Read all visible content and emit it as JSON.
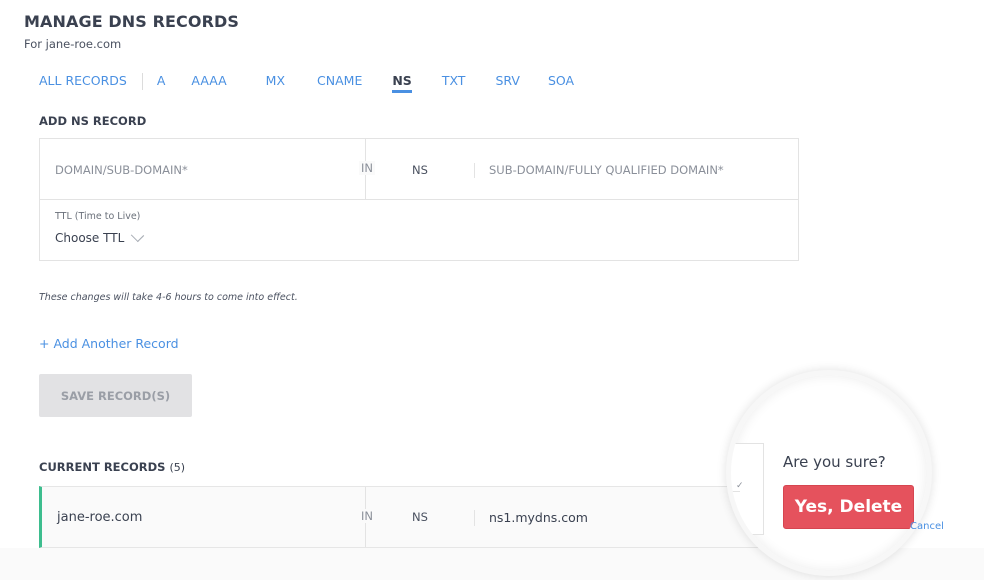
{
  "header": {
    "title": "MANAGE DNS RECORDS",
    "subtitle": "For jane-roe.com"
  },
  "tabs": [
    {
      "label": "ALL RECORDS",
      "active": false
    },
    {
      "label": "A",
      "active": false
    },
    {
      "label": "AAAA",
      "active": false
    },
    {
      "label": "MX",
      "active": false
    },
    {
      "label": "CNAME",
      "active": false
    },
    {
      "label": "NS",
      "active": true
    },
    {
      "label": "TXT",
      "active": false
    },
    {
      "label": "SRV",
      "active": false
    },
    {
      "label": "SOA",
      "active": false
    }
  ],
  "add_form": {
    "title": "ADD NS RECORD",
    "domain_placeholder": "DOMAIN/SUB-DOMAIN*",
    "class_label": "IN",
    "type_label": "NS",
    "target_placeholder": "SUB-DOMAIN/FULLY QUALIFIED DOMAIN*",
    "ttl_label": "TTL (Time to Live)",
    "ttl_value": "Choose TTL"
  },
  "note": "These changes will take 4-6 hours to come into effect.",
  "add_another_label": "+ Add Another Record",
  "save_label": "SAVE RECORD(S)",
  "current_records": {
    "title": "CURRENT RECORDS",
    "count": "(5)",
    "rows": [
      {
        "domain": "jane-roe.com",
        "class": "IN",
        "type": "NS",
        "value": "ns1.mydns.com"
      }
    ]
  },
  "confirm": {
    "question": "Are you sure?",
    "confirm_label": "Yes, Delete",
    "cancel_label": "Cancel"
  },
  "colors": {
    "accent": "#4a90e2",
    "danger": "#e5525d",
    "record_marker": "#3dbd8e"
  }
}
